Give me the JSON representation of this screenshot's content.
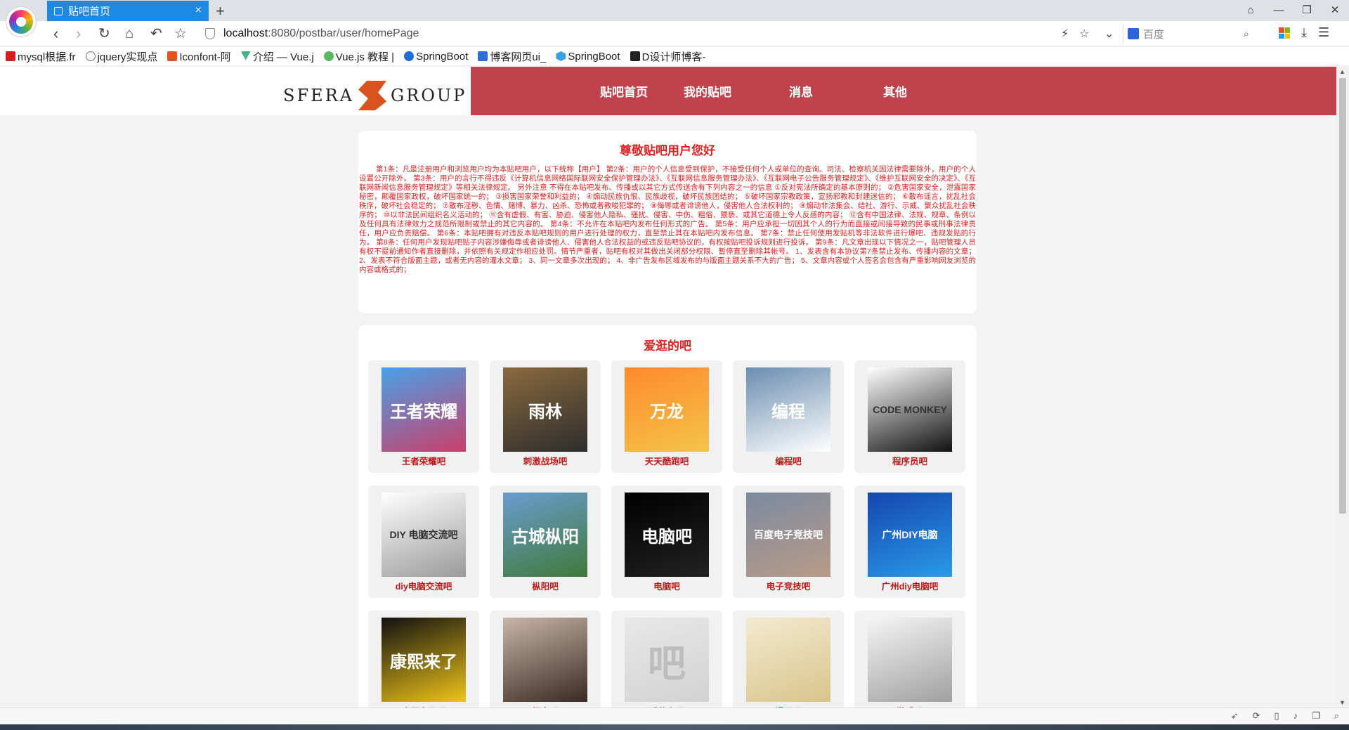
{
  "browser": {
    "tab_title": "贴吧首页",
    "url_host": "localhost",
    "url_path": ":8080/postbar/user/homePage",
    "search_placeholder": "百度"
  },
  "bookmarks": [
    "mysql根据.fr",
    "jquery实现点",
    "Iconfont-阿",
    "介绍 — Vue.j",
    "Vue.js 教程 |",
    "SpringBoot",
    "博客网页ui_",
    "SpringBoot",
    "D设计师博客-"
  ],
  "site": {
    "brand_left": "SFERA",
    "brand_right": "GROUP",
    "nav": [
      "贴吧首页",
      "我的贴吧",
      "消息",
      "其他"
    ]
  },
  "notice": {
    "title": "尊敬贴吧用户您好",
    "body": "第1条：凡是注册用户和浏览用户均为本贴吧用户，以下统称【用户】 第2条：用户的个人信息受到保护，不接受任何个人或单位的查询。司法、检察机关因法律需要除外，用户的个人设置公开除外。 第3条：用户的言行不得违反《计算机信息网络国际联网安全保护管理办法》、《互联网信息服务管理办法》、《互联网电子公告服务管理规定》、《维护互联网安全的决定》、《互联网新闻信息服务管理规定》等相关法律规定。 另外注意 不得在本贴吧发布、传播或以其它方式传送含有下列内容之一的信息 ①反对宪法所确定的基本原则的； ②危害国家安全，泄露国家秘密，颠覆国家政权，破坏国家统一的； ③损害国家荣誉和利益的； ④煽动民族仇恨、民族歧视，破坏民族团结的； ⑤破坏国家宗教政策，宣扬邪教和封建迷信的； ⑥散布谣言，扰乱社会秩序，破坏社会稳定的； ⑦散布淫秽、色情、赌博、暴力、凶杀、恐怖或者教唆犯罪的； ⑧侮辱或者诽谤他人，侵害他人合法权利的； ⑨煽动非法集会、结社、游行、示威、聚众扰乱社会秩序的； ⑩以非法民间组织名义活动的； ⑪含有虚假、有害、胁迫、侵害他人隐私、骚扰、侵害、中伤、粗俗、猥亵、或其它道德上令人反感的内容； ⑫含有中国法律、法规、规章、条例以及任何具有法律效力之规范所限制或禁止的其它内容的。 第4条：不允许在本贴吧内发布任何形式的广告。 第5条：用户应承担一切因其个人的行为而直接或间接导致的民事或刑事法律责任，用户应负责赔偿。 第6条：本贴吧拥有对违反本贴吧规则的用户进行处理的权力，直至禁止其在本贴吧内发布信息。 第7条：禁止任何使用发贴机等非法软件进行爆吧、违规发贴的行为。 第8条：任何用户发现贴吧贴子内容涉嫌侮辱或者诽谤他人、侵害他人合法权益的或违反贴吧协议的，有权按贴吧投诉规则进行投诉。 第9条：凡文章出现以下情况之一，贴吧管理人员有权不提前通知作者直接删除，并依照有关规定作相应处罚。情节严重者，贴吧有权对其做出关闭部分权限、暂停直至删除其帐号。 1、发表含有本协议第7条禁止发布、传播内容的文章； 2、发表不符合版面主题，或者无内容的灌水文章； 3、同一文章多次出现的； 4、非广告发布区域发布的与版面主题关系不大的广告； 5、文章内容或个人签名会包含有严重影响网友浏览的内容或格式的；"
  },
  "favorites": {
    "title": "爱逛的吧",
    "bars": [
      {
        "name": "王者荣耀吧",
        "img_text": "王者荣耀",
        "colors": [
          "#4aa0e8",
          "#c8406a"
        ]
      },
      {
        "name": "刺激战场吧",
        "img_text": "雨林",
        "colors": [
          "#8a6a3e",
          "#2d2d2d"
        ]
      },
      {
        "name": "天天酷跑吧",
        "img_text": "万龙",
        "colors": [
          "#ff8a2a",
          "#f4c44a"
        ]
      },
      {
        "name": "编程吧",
        "img_text": "编程",
        "colors": [
          "#6a8db0",
          "#ffffff"
        ]
      },
      {
        "name": "程序员吧",
        "img_text": "CODE MONKEY",
        "colors": [
          "#ffffff",
          "#111111"
        ]
      },
      {
        "name": "diy电脑交流吧",
        "img_text": "DIY 电脑交流吧",
        "colors": [
          "#ffffff",
          "#9a9a9a"
        ]
      },
      {
        "name": "枞阳吧",
        "img_text": "古城枞阳",
        "colors": [
          "#6a9ccf",
          "#3f7a3a"
        ]
      },
      {
        "name": "电脑吧",
        "img_text": "电脑吧",
        "colors": [
          "#000000",
          "#222222"
        ]
      },
      {
        "name": "电子竞技吧",
        "img_text": "百度电子竞技吧",
        "colors": [
          "#7b8aa0",
          "#b99b87"
        ]
      },
      {
        "name": "广州diy电脑吧",
        "img_text": "广州DIY电脑",
        "colors": [
          "#1446b0",
          "#2a9ae8"
        ]
      },
      {
        "name": "康熙电子吧",
        "img_text": "康熙来了",
        "colors": [
          "#111111",
          "#f0c418"
        ]
      },
      {
        "name": "烦宁吧",
        "img_text": "",
        "colors": [
          "#c9b5a8",
          "#3b2a22"
        ]
      },
      {
        "name": "爱什么吧",
        "img_text": "吧",
        "colors": [
          "#e8e8e8",
          "#d2d2d2"
        ]
      },
      {
        "name": "漫画吧",
        "img_text": "",
        "colors": [
          "#f3ead1",
          "#d9c48a"
        ]
      },
      {
        "name": "游戏吧",
        "img_text": "",
        "colors": [
          "#f5f5f5",
          "#a0a0a0"
        ]
      }
    ]
  }
}
